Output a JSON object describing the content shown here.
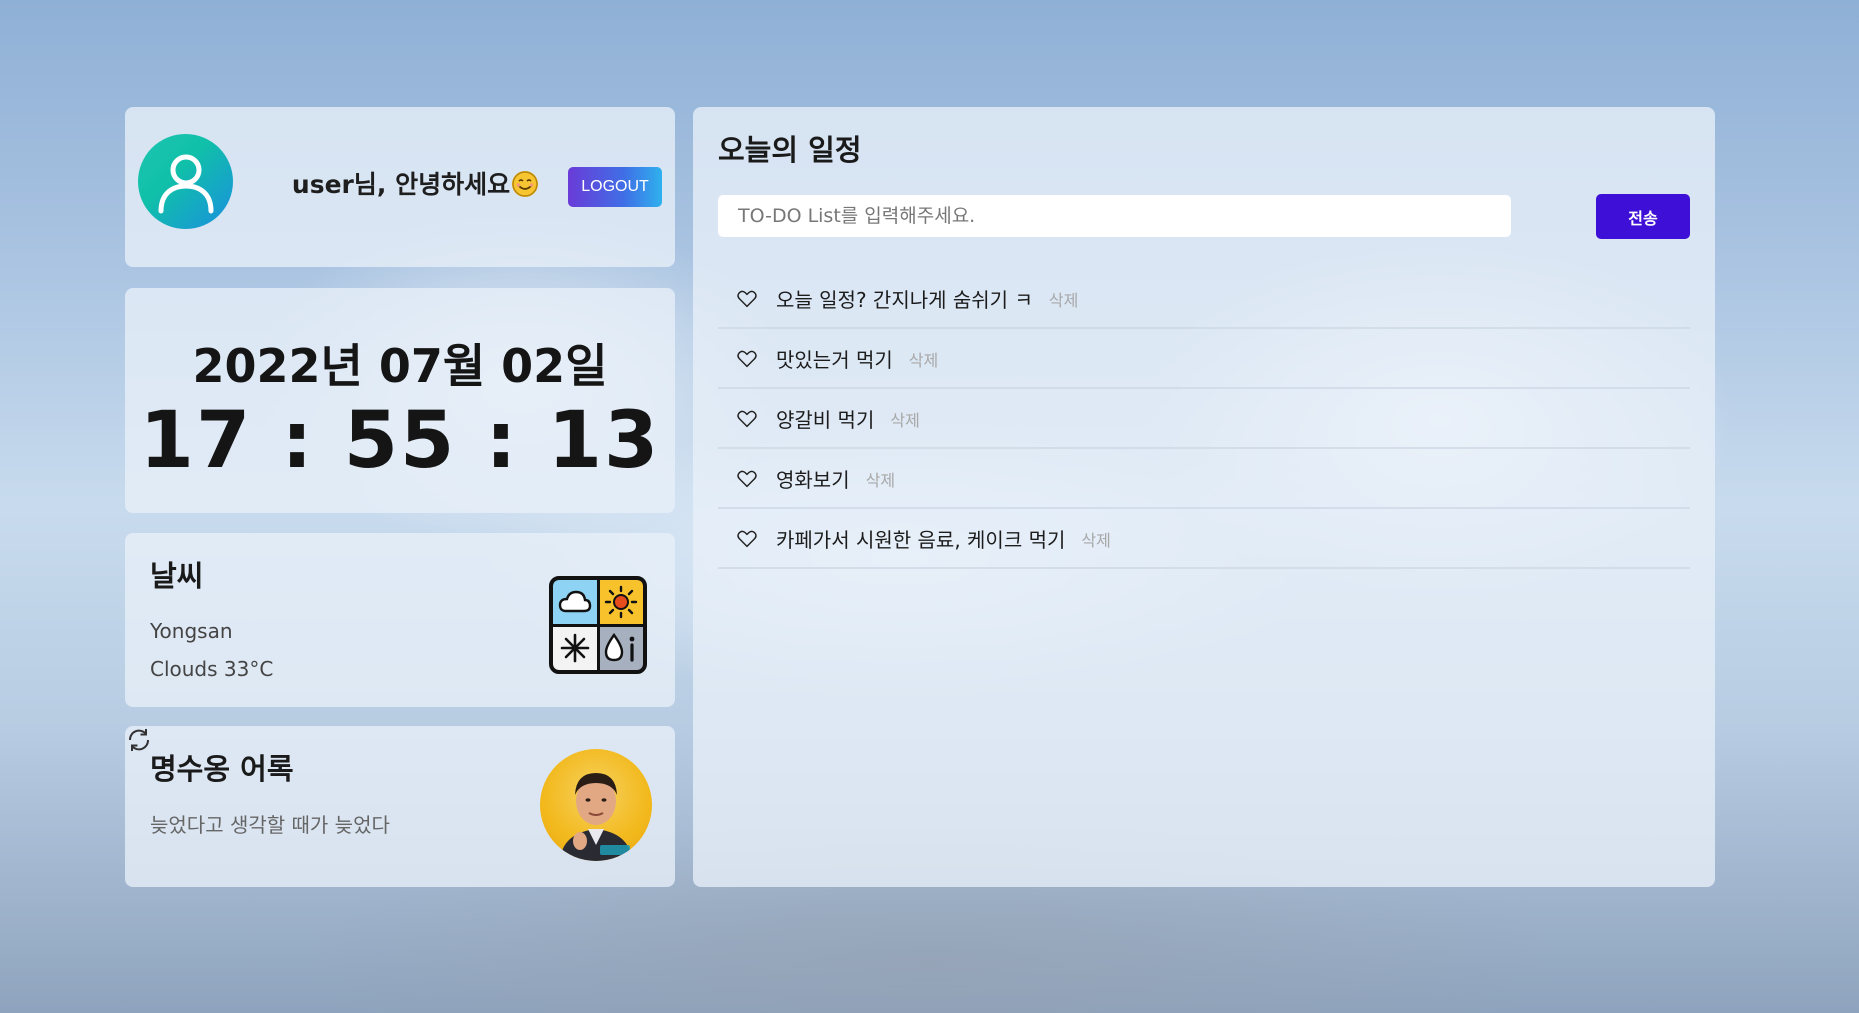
{
  "profile": {
    "greeting": "user님, 안녕하세요",
    "emoji_icon": "smiling-face-icon",
    "logout_label": "LOGOUT",
    "avatar_icon": "user-icon"
  },
  "clock": {
    "date": "2022년 07월 02일",
    "time": "17 : 55 : 13"
  },
  "weather": {
    "title": "날씨",
    "city": "Yongsan",
    "condition": "Clouds 33°C",
    "icon": "weather-icon"
  },
  "quote": {
    "title": "명수옹 어록",
    "text": "늦었다고 생각할 때가 늦었다",
    "refresh_icon": "refresh-icon",
    "image": "person-avatar"
  },
  "todo": {
    "title": "오늘의 일정",
    "input_placeholder": "TO-DO List를 입력해주세요.",
    "send_label": "전송",
    "delete_label": "삭제",
    "items": [
      {
        "text": "오늘 일정? 간지나게 숨쉬기 ㅋ"
      },
      {
        "text": "맛있는거 먹기"
      },
      {
        "text": "양갈비 먹기"
      },
      {
        "text": "영화보기"
      },
      {
        "text": "카페가서 시원한 음료, 케이크 먹기"
      }
    ]
  }
}
